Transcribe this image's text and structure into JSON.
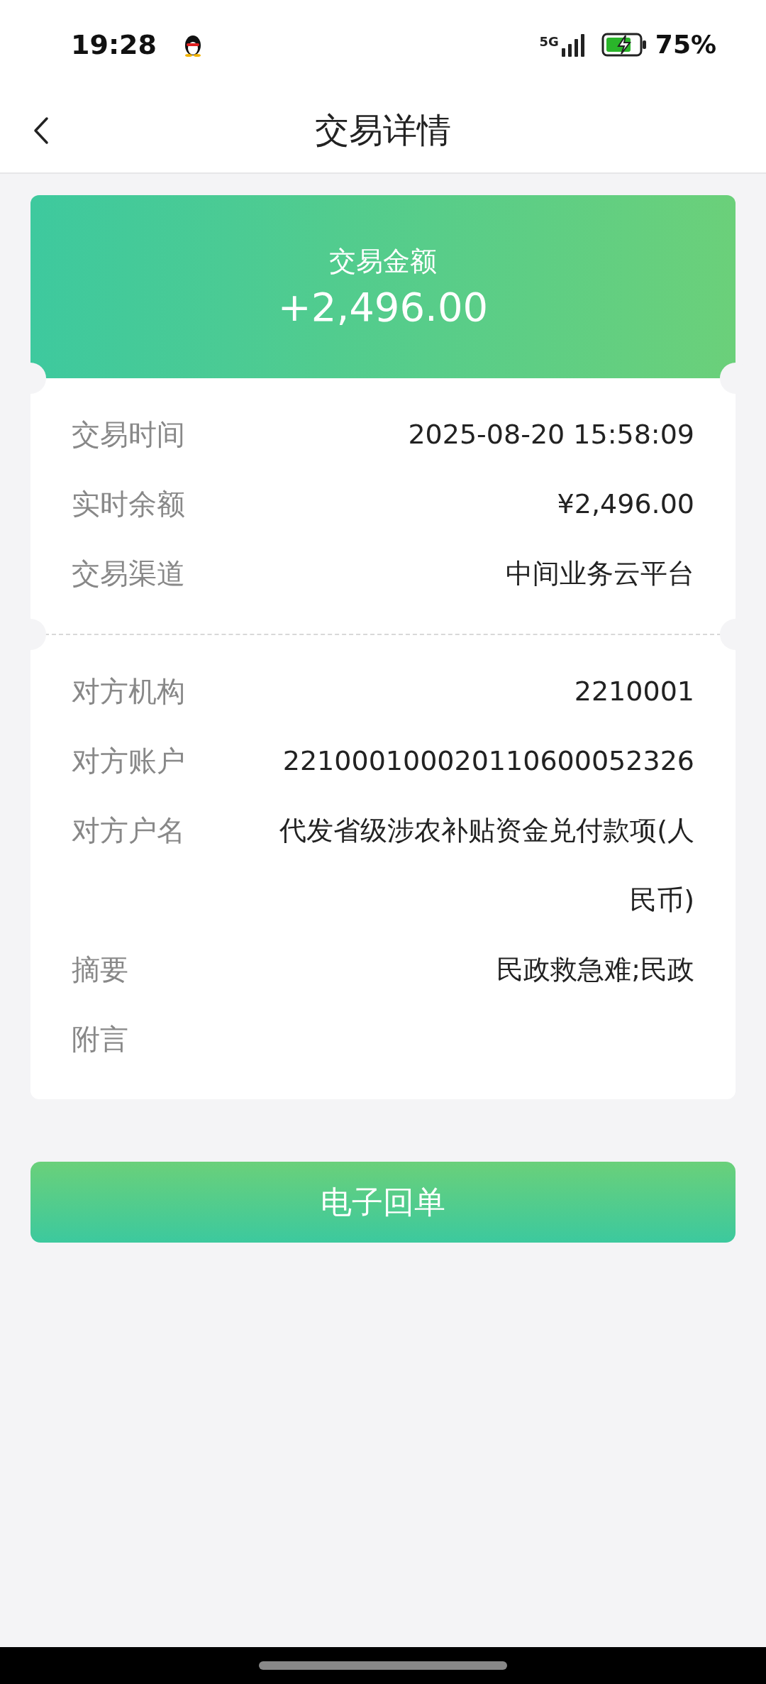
{
  "status_bar": {
    "time": "19:28",
    "network": "5G",
    "battery": "75%"
  },
  "header": {
    "title": "交易详情"
  },
  "amount_card": {
    "label": "交易金额",
    "amount": "+2,496.00"
  },
  "sections": [
    {
      "rows": [
        {
          "label": "交易时间",
          "value": "2025-08-20 15:58:09"
        },
        {
          "label": "实时余额",
          "value": "¥2,496.00"
        },
        {
          "label": "交易渠道",
          "value": "中间业务云平台"
        }
      ]
    },
    {
      "rows": [
        {
          "label": "对方机构",
          "value": "2210001"
        },
        {
          "label": "对方账户",
          "value": "221000100020110600052326"
        },
        {
          "label": "对方户名",
          "value": "代发省级涉农补贴资金兑付款项(人民币)"
        },
        {
          "label": "摘要",
          "value": "民政救急难;民政"
        },
        {
          "label": "附言"
        }
      ]
    }
  ],
  "button": "电子回单"
}
